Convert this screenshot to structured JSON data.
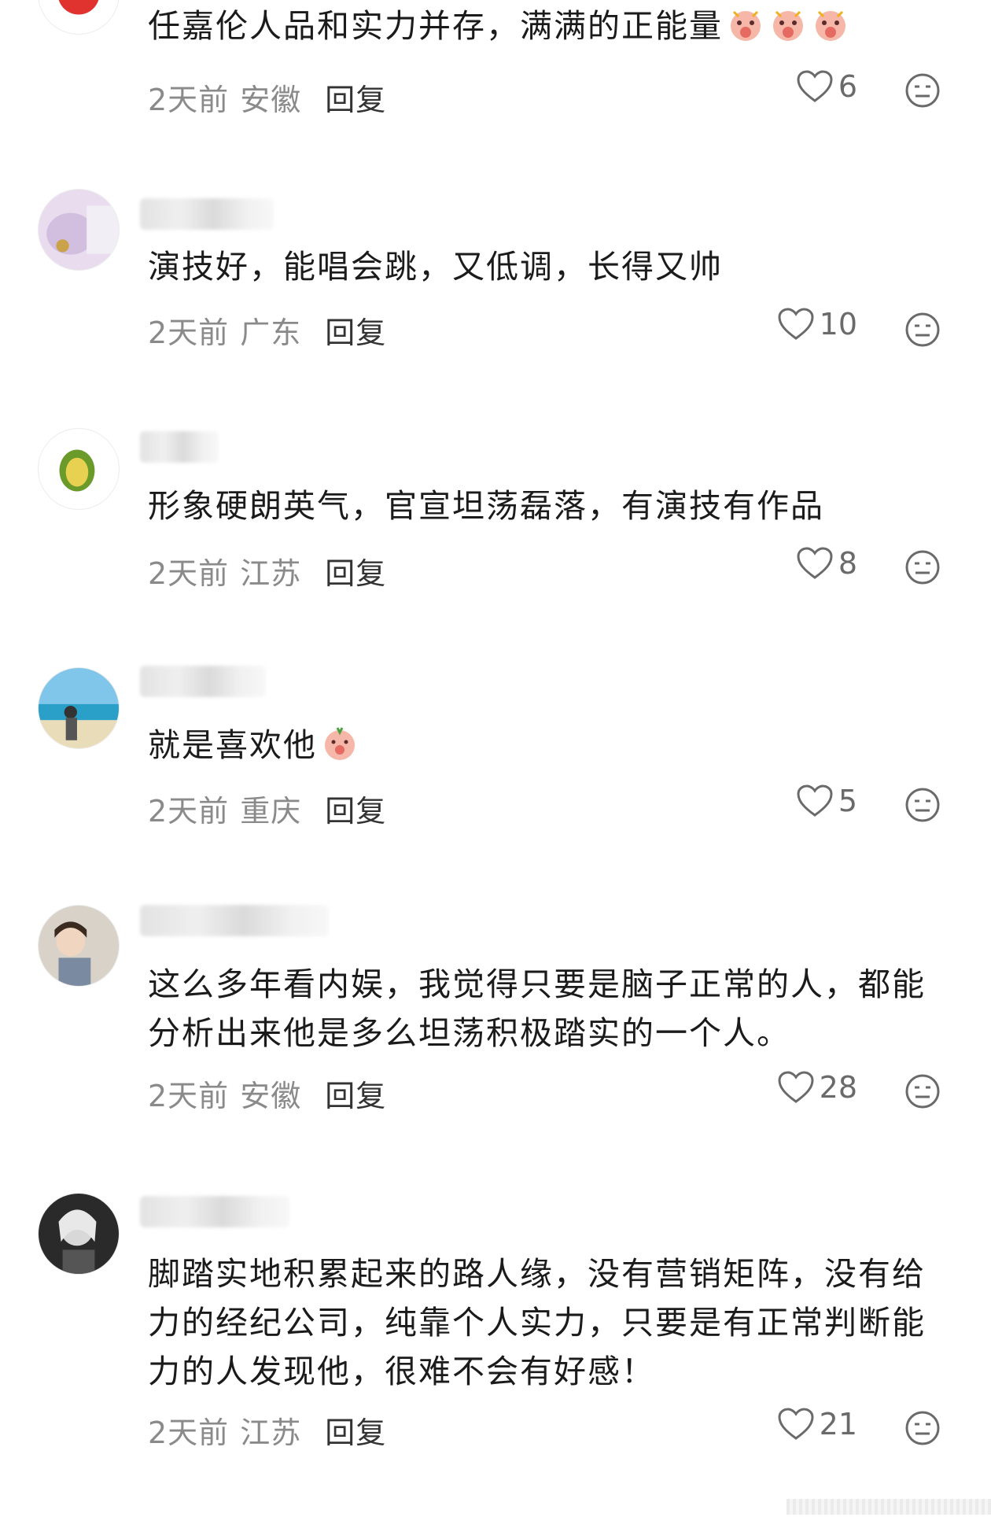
{
  "comments": [
    {
      "text": "任嘉伦人品和实力并存，满满的正能量",
      "emoji": [
        "pig-excited-emoji",
        "pig-excited-emoji",
        "pig-excited-emoji"
      ],
      "time": "2天前",
      "region": "安徽",
      "reply_label": "回复",
      "likes": "6"
    },
    {
      "text": "演技好，能唱会跳，又低调，长得又帅",
      "time": "2天前",
      "region": "广东",
      "reply_label": "回复",
      "likes": "10"
    },
    {
      "text": "形象硬朗英气，官宣坦荡磊落，有演技有作品",
      "time": "2天前",
      "region": "江苏",
      "reply_label": "回复",
      "likes": "8"
    },
    {
      "text": "就是喜欢他",
      "emoji": [
        "pig-shy-emoji"
      ],
      "time": "2天前",
      "region": "重庆",
      "reply_label": "回复",
      "likes": "5"
    },
    {
      "text": "这么多年看内娱，我觉得只要是脑子正常的人，都能分析出来他是多么坦荡积极踏实的一个人。",
      "time": "2天前",
      "region": "安徽",
      "reply_label": "回复",
      "likes": "28"
    },
    {
      "text": "脚踏实地积累起来的路人缘，没有营销矩阵，没有给力的经纪公司，纯靠个人实力，只要是有正常判断能力的人发现他，很难不会有好感！",
      "time": "2天前",
      "region": "江苏",
      "reply_label": "回复",
      "likes": "21"
    }
  ],
  "icons": {
    "like": "heart-outline-icon",
    "dislike": "neutral-face-icon"
  },
  "colors": {
    "text": "#1b1b1b",
    "meta": "#8a8a8a",
    "icon": "#6a6a6a"
  }
}
